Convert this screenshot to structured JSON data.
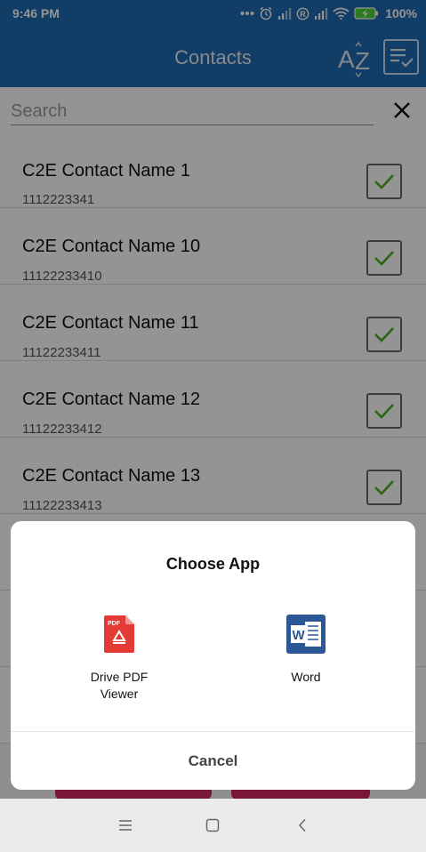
{
  "status_bar": {
    "time": "9:46 PM",
    "battery_percent": "100%",
    "icons": [
      "more-dots-icon",
      "alarm-icon",
      "signal-icon",
      "registered-icon",
      "signal-icon",
      "wifi-icon",
      "battery-charging-icon"
    ]
  },
  "app_bar": {
    "title": "Contacts",
    "sort_az_icon": "sort-az-icon",
    "sort_list_icon": "sort-list-icon"
  },
  "search": {
    "placeholder": "Search",
    "value": "",
    "clear_icon": "close-icon"
  },
  "contacts": [
    {
      "name": "C2E Contact Name 1",
      "phone": "1112223341",
      "checked": true
    },
    {
      "name": "C2E Contact Name 10",
      "phone": "11122233410",
      "checked": true
    },
    {
      "name": "C2E Contact Name 11",
      "phone": "11122233411",
      "checked": true
    },
    {
      "name": "C2E Contact Name 12",
      "phone": "11122233412",
      "checked": true
    },
    {
      "name": "C2E Contact Name 13",
      "phone": "11122233413",
      "checked": true
    }
  ],
  "dialog": {
    "title": "Choose App",
    "apps": [
      {
        "label": "Drive PDF Viewer",
        "icon": "drive-pdf-viewer-icon"
      },
      {
        "label": "Word",
        "icon": "word-icon"
      }
    ],
    "cancel_label": "Cancel"
  },
  "nav_bar": {
    "icons": [
      "menu-icon",
      "home-icon",
      "back-icon"
    ]
  },
  "colors": {
    "primary": "#1f6ab1",
    "check": "#4caf1e",
    "accent_button": "#d1285e",
    "pdf_red": "#e53935",
    "word_blue": "#2b5797"
  }
}
